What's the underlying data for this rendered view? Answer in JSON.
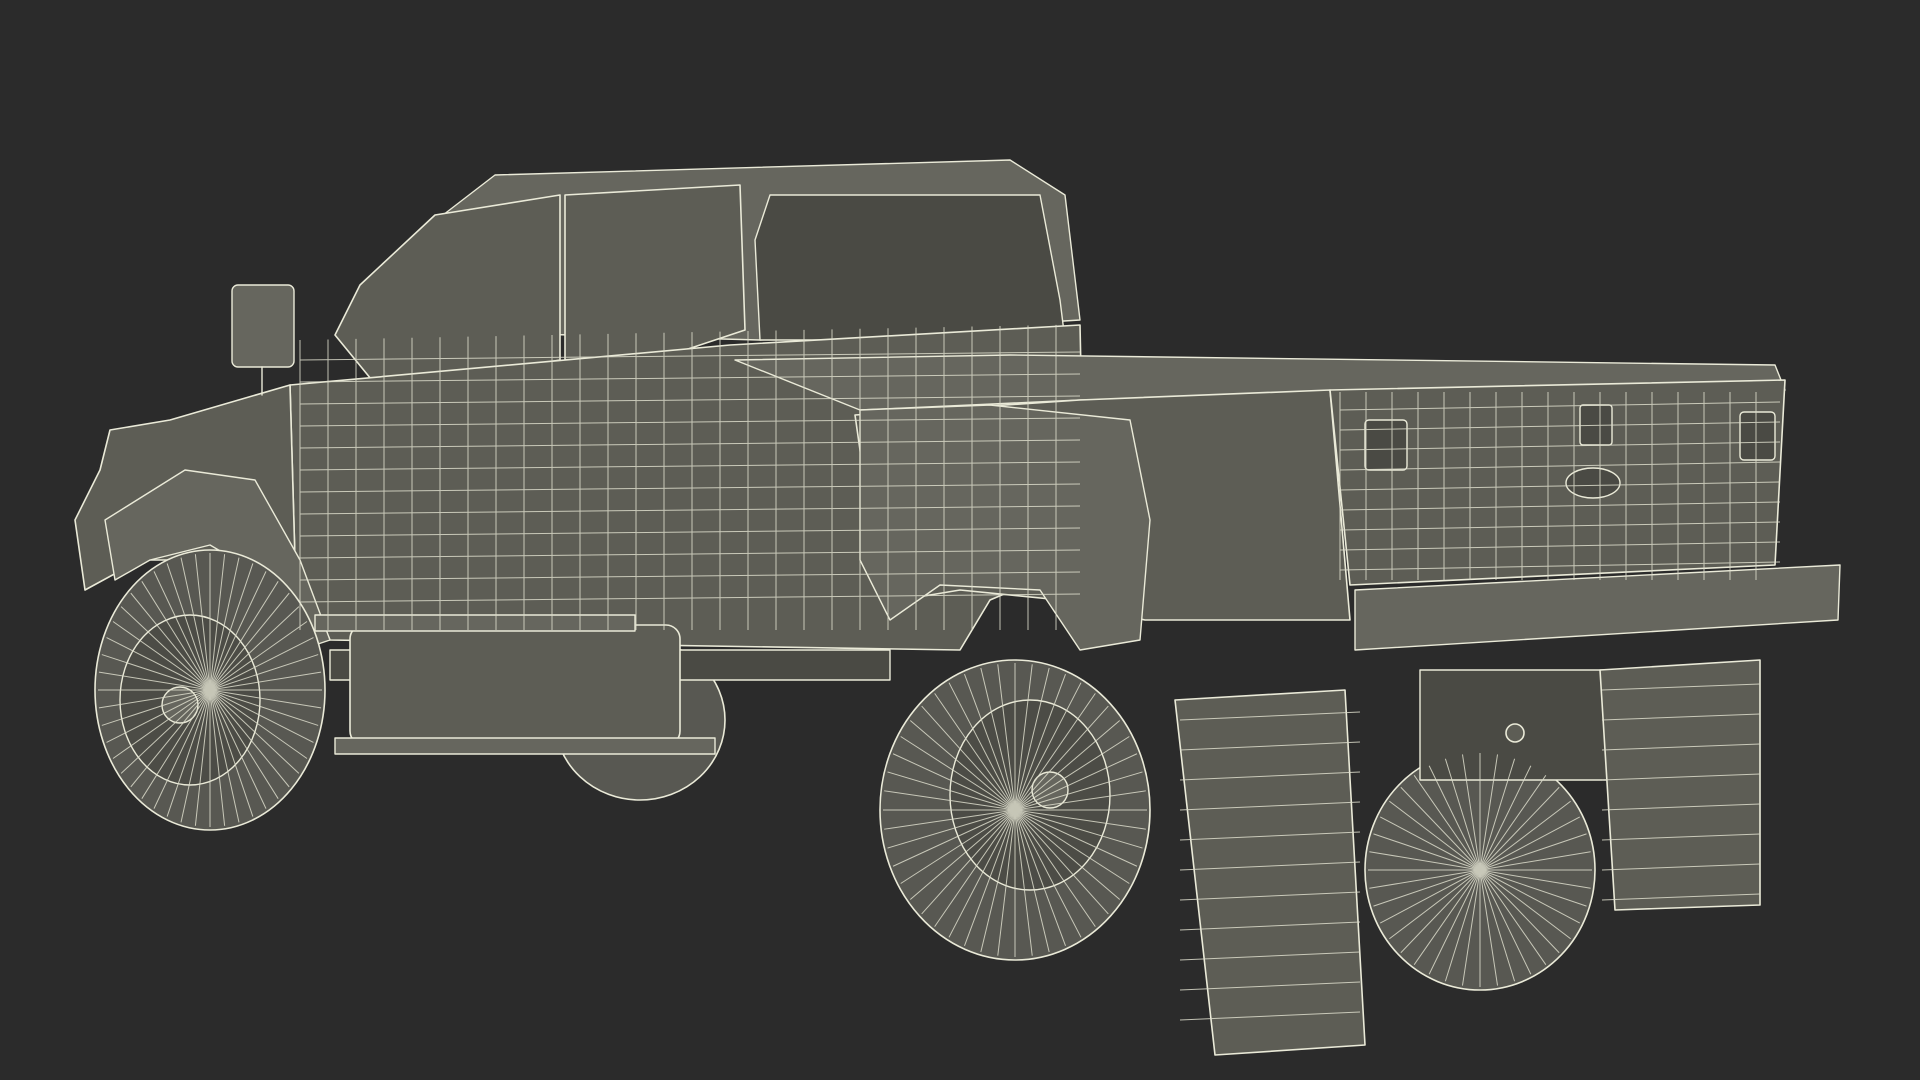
{
  "viewport": {
    "background_color": "#2b2b2b",
    "wire_color": "#eaead8",
    "surface_color": "#5d5d55",
    "subject": "pickup-truck-wireframe"
  }
}
